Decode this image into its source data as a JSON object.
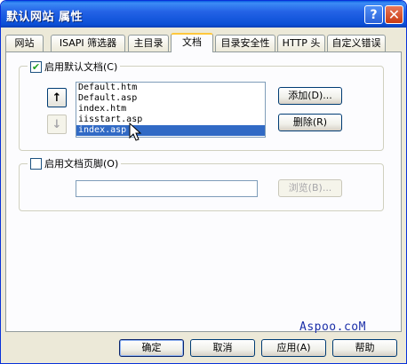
{
  "window": {
    "title": "默认网站 属性",
    "help_label": "?",
    "close_label": "✕"
  },
  "tabs": [
    {
      "label": "网站"
    },
    {
      "label": "ISAPI 筛选器"
    },
    {
      "label": "主目录"
    },
    {
      "label": "文档",
      "active": true
    },
    {
      "label": "目录安全性"
    },
    {
      "label": "HTTP 头"
    },
    {
      "label": "自定义错误"
    }
  ],
  "default_docs": {
    "checkbox_label": "启用默认文档(C)",
    "checked": true,
    "up_label": "↑",
    "down_label": "↓",
    "items": [
      "Default.htm",
      "Default.asp",
      "index.htm",
      "iisstart.asp",
      "index.asp"
    ],
    "selected_index": 4,
    "add_label": "添加(D)...",
    "remove_label": "删除(R)"
  },
  "footer_doc": {
    "checkbox_label": "启用文档页脚(O)",
    "checked": false,
    "path_value": "",
    "browse_label": "浏览(B)..."
  },
  "watermark": "Aspoo.coM",
  "buttons": {
    "ok": "确定",
    "cancel": "取消",
    "apply": "应用(A)",
    "help": "帮助"
  }
}
